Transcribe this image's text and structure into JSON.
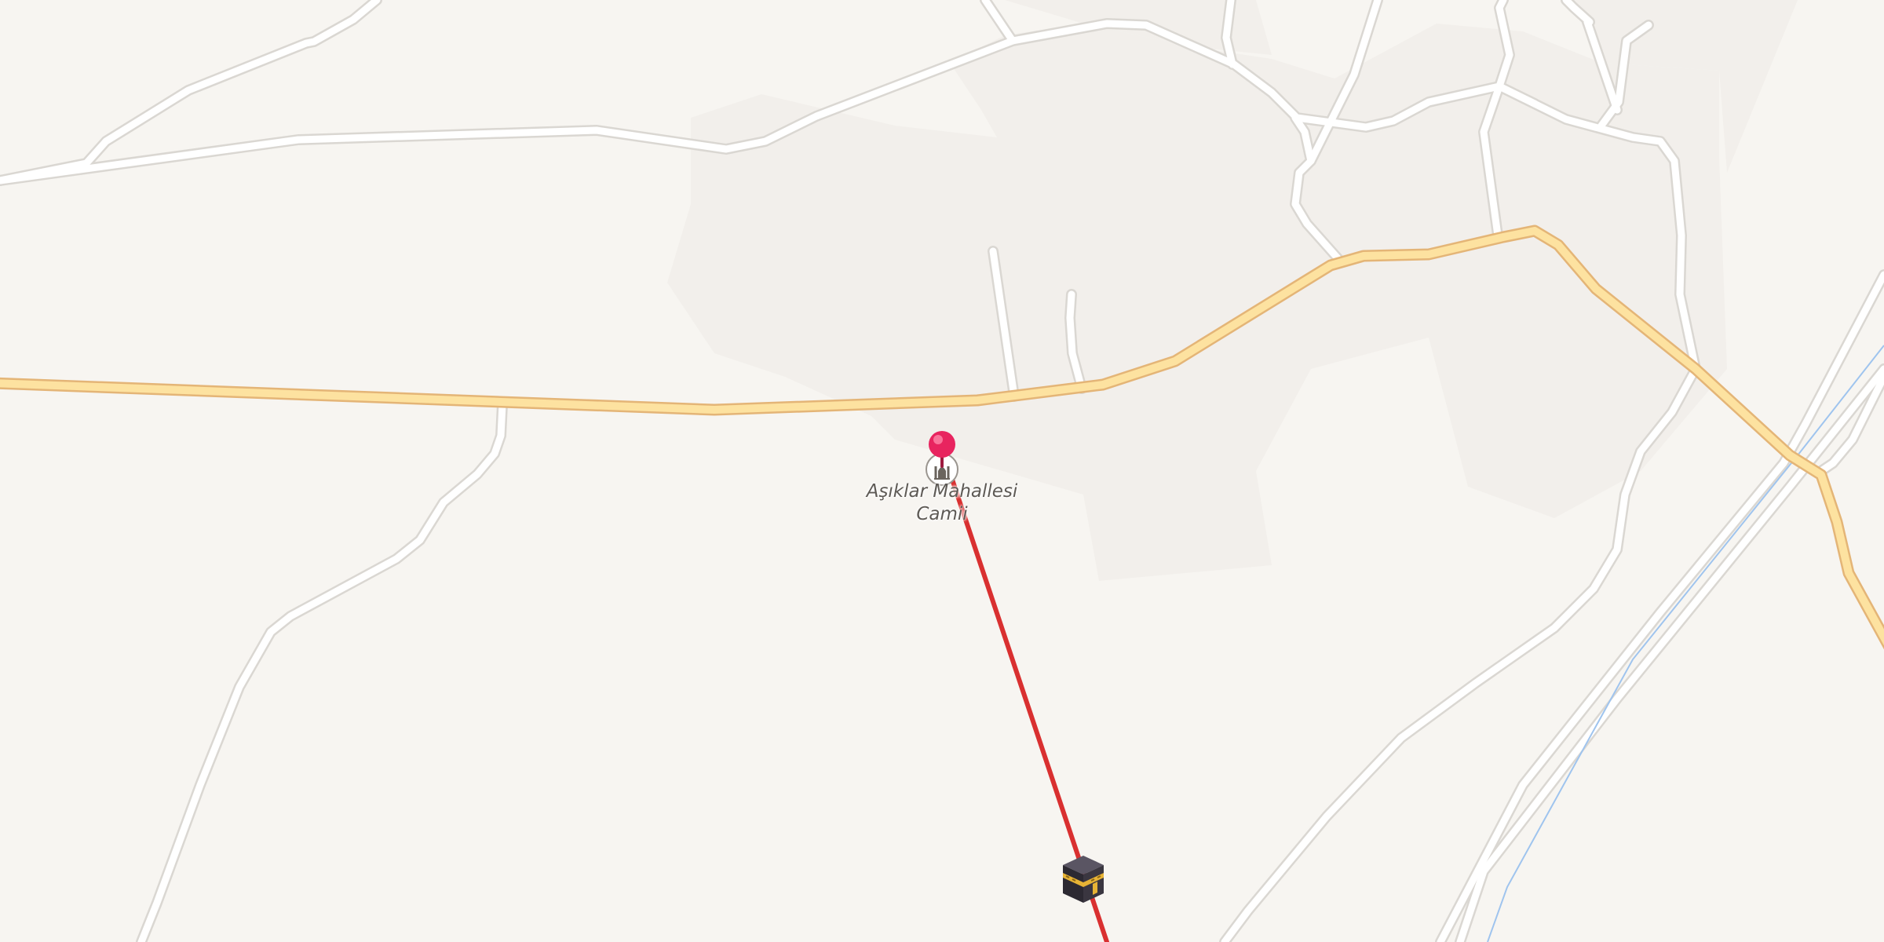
{
  "map": {
    "poi": {
      "name_line1": "Aşıklar Mahallesi",
      "name_line2": "Camii",
      "icon": "mosque-icon"
    },
    "marker": {
      "icon": "pin-icon",
      "color": "#e8245f"
    },
    "destination": {
      "icon": "kaaba-icon"
    },
    "qibla_line": {
      "color": "#d93030"
    },
    "colors": {
      "background": "#f7f5f1",
      "landuse": "#f1eeea",
      "road_fill": "#ffffff",
      "road_casing": "#dad7d2",
      "main_road_fill": "#fde2a0",
      "main_road_casing": "#e4b577",
      "waterway": "#9fc4ee"
    }
  }
}
